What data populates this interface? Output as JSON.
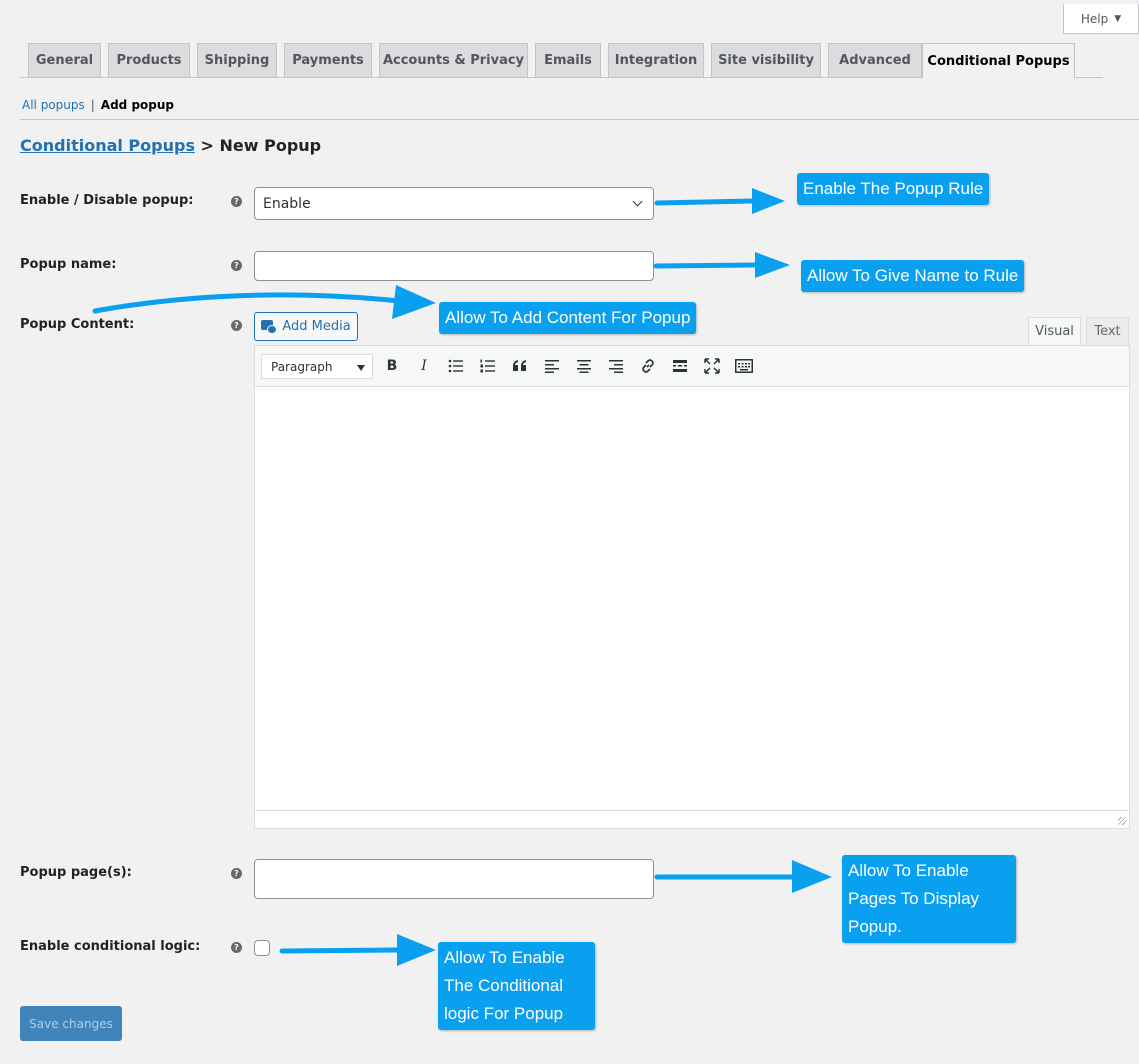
{
  "help": {
    "label": "Help",
    "caret": "▼"
  },
  "tabs": [
    {
      "label": "General"
    },
    {
      "label": "Products"
    },
    {
      "label": "Shipping"
    },
    {
      "label": "Payments"
    },
    {
      "label": "Accounts & Privacy"
    },
    {
      "label": "Emails"
    },
    {
      "label": "Integration"
    },
    {
      "label": "Site visibility"
    },
    {
      "label": "Advanced"
    },
    {
      "label": "Conditional Popups",
      "active": true
    }
  ],
  "subnav": {
    "all_label": "All popups",
    "separator": "|",
    "add_label": "Add popup"
  },
  "heading": {
    "link": "Conditional Popups",
    "rest": "> New Popup"
  },
  "form": {
    "enable": {
      "label": "Enable / Disable popup:",
      "value": "Enable"
    },
    "name": {
      "label": "Popup name:",
      "value": ""
    },
    "content": {
      "label": "Popup Content:",
      "add_media": "Add Media",
      "tab_visual": "Visual",
      "tab_text": "Text",
      "format": "Paragraph"
    },
    "pages": {
      "label": "Popup page(s):",
      "value": ""
    },
    "logic": {
      "label": "Enable conditional logic:",
      "checked": false
    },
    "help_glyph": "?"
  },
  "toolbar_icons": {
    "bold": "B",
    "italic": "I"
  },
  "save_label": "Save changes",
  "callouts": {
    "enable": "Enable The Popup Rule",
    "name": "Allow To Give Name to Rule",
    "content": "Allow To Add Content For Popup",
    "pages": "Allow To Enable Pages To Display Popup.",
    "logic": "Allow To Enable The Conditional logic For Popup"
  },
  "colors": {
    "accent": "#2271b1",
    "callout": "#0aa0f0"
  }
}
